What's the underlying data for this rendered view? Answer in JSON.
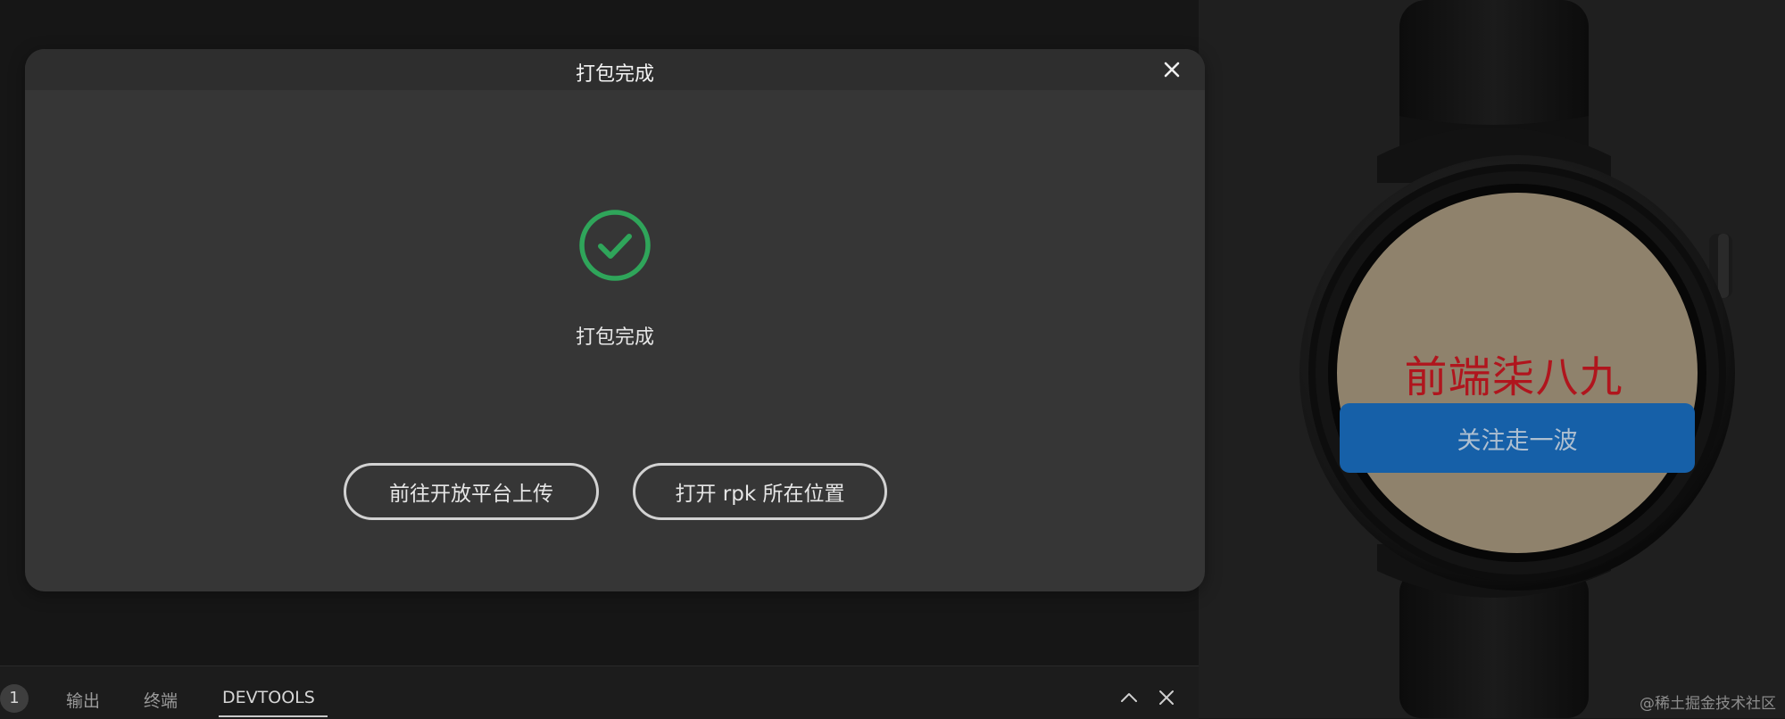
{
  "dialog": {
    "title": "打包完成",
    "close_icon": "close-icon",
    "status_icon": "check-circle-icon",
    "status_text": "打包完成",
    "upload_button_label": "前往开放平台上传",
    "open_location_button_label": "打开 rpk 所在位置"
  },
  "bottom_panel": {
    "badge_count": "1",
    "tabs": [
      {
        "label": "输出"
      },
      {
        "label": "终端"
      },
      {
        "label": "DEVTOOLS",
        "active": true
      }
    ],
    "collapse_icon": "chevron-up-icon",
    "close_icon": "close-icon"
  },
  "watch": {
    "title": "前端柒八九",
    "button_label": "关注走一波",
    "colors": {
      "screen_bg": "#8f826c",
      "title": "#b0151d",
      "button": "#1660a8"
    }
  },
  "watermark": "@稀土掘金技术社区",
  "colors": {
    "success": "#2fa55a",
    "dialog_bg": "#363636",
    "app_bg": "#161616"
  }
}
